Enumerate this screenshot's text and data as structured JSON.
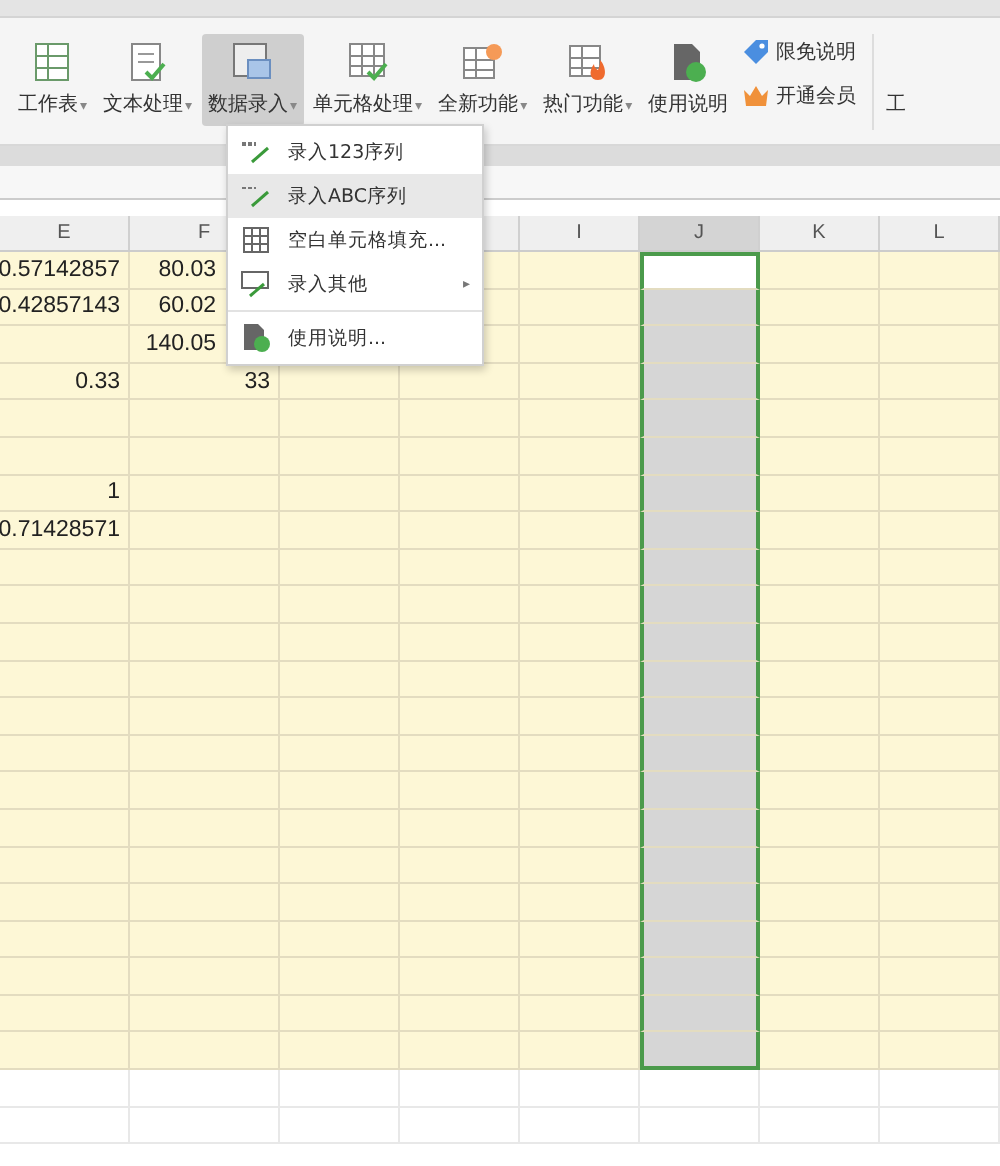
{
  "ribbon": {
    "buttons": [
      {
        "label": "工作表",
        "caret": "▾",
        "selected": false,
        "kind": "sheet"
      },
      {
        "label": "文本处理",
        "caret": "▾",
        "selected": false,
        "kind": "text"
      },
      {
        "label": "数据录入",
        "caret": "▾",
        "selected": true,
        "kind": "data"
      },
      {
        "label": "单元格处理",
        "caret": "▾",
        "selected": false,
        "kind": "cell"
      },
      {
        "label": "全新功能",
        "caret": "▾",
        "selected": false,
        "kind": "new"
      },
      {
        "label": "热门功能",
        "caret": "▾",
        "selected": false,
        "kind": "hot"
      },
      {
        "label": "使用说明",
        "selected": false,
        "kind": "help"
      }
    ],
    "small_buttons": [
      {
        "label": "限免说明",
        "kind": "tag"
      },
      {
        "label": "开通会员",
        "kind": "crown"
      }
    ],
    "cut_button": "工"
  },
  "menu": {
    "items": [
      {
        "label": "录入123序列",
        "kind": "num",
        "selected": false
      },
      {
        "label": "录入ABC序列",
        "kind": "abc",
        "selected": true
      },
      {
        "label": "空白单元格填充...",
        "kind": "grid",
        "selected": false
      },
      {
        "label": "录入其他",
        "kind": "other",
        "selected": false,
        "submenu": "▸"
      },
      {
        "label": "使用说明...",
        "kind": "doc",
        "selected": false,
        "separator_before": true
      }
    ]
  },
  "sheet": {
    "columns": [
      {
        "letter": "E",
        "selected": false
      },
      {
        "letter": "F",
        "selected": false
      },
      {},
      {},
      {
        "letter": "I",
        "selected": false
      },
      {
        "letter": "J",
        "selected": true
      },
      {
        "letter": "K",
        "selected": false
      },
      {
        "letter": "L",
        "selected": false
      }
    ],
    "rows": [
      {
        "E": "0.57142857",
        "F": "80.03"
      },
      {
        "E": "0.42857143",
        "F": "60.02"
      },
      {
        "F": "140.05"
      },
      {
        "E": "0.33",
        "F": "33"
      },
      {},
      {},
      {
        "E": "1"
      },
      {
        "E": "0.71428571"
      }
    ]
  }
}
